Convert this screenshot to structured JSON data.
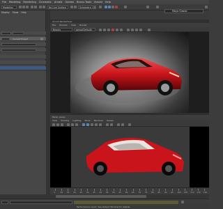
{
  "menubar": {
    "items": [
      "File",
      "Modeling",
      "Rendering",
      "Cinematic",
      "Arnold",
      "Games",
      "Bonus Tools",
      "Arnold",
      "Help"
    ]
  },
  "toolbar": {
    "mode_dropdown": "Modeling",
    "object_dropdown": "No Live Surface",
    "symmetry_dropdown": "Symmetry: Off",
    "workspace_label": "Maya Classic"
  },
  "left_panel": {
    "menu": [
      "Display",
      "Show",
      "Help"
    ],
    "field_label": "Current Project"
  },
  "render_view": {
    "title": "Arnold RenderView",
    "menu": [
      "File",
      "Window",
      "View",
      "Render"
    ],
    "camera_dropdown": "Beauty",
    "aov_dropdown": "persp(Default)"
  },
  "viewport": {
    "title": "Panel: persp",
    "menu": [
      "View",
      "Shading",
      "Lighting",
      "Show",
      "Renderer",
      "Panels"
    ]
  },
  "timeline": {
    "ticks": [
      "5",
      "10",
      "15",
      "20",
      "25",
      "30",
      "35",
      "40",
      "45",
      "50",
      "55",
      "60",
      "65",
      "70",
      "75",
      "80",
      "85",
      "90",
      "95",
      "100",
      "105",
      "110",
      "115",
      "120"
    ]
  },
  "help_line": {
    "text": "Performance count. See Output Window for details."
  },
  "colors": {
    "car_body": "#c8141a",
    "ui_bg": "#3c3c3c",
    "workspace_accent": "#5a84b8"
  }
}
